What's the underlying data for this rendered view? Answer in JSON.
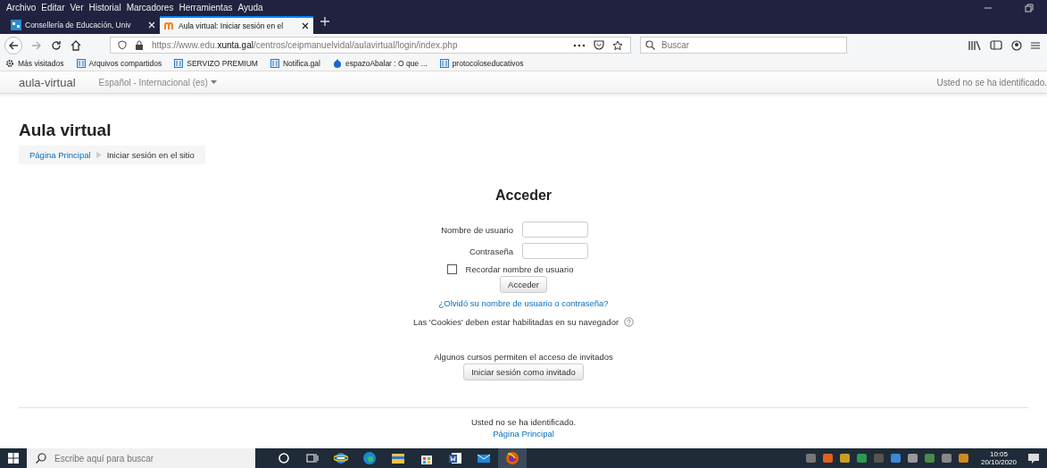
{
  "menu_bar": [
    "Archivo",
    "Editar",
    "Ver",
    "Historial",
    "Marcadores",
    "Herramientas",
    "Ayuda"
  ],
  "tabs": [
    {
      "label": "Consellería de Educación, Univ",
      "selected": false
    },
    {
      "label": "Aula virtual: Iniciar sesión en el",
      "selected": true
    }
  ],
  "address_bar": {
    "url_start": "https://www.edu.",
    "url_domain": "xunta.gal",
    "url_rest": "/centros/ceipmanuelvidal/aulavirtual/login/index.php"
  },
  "search": {
    "placeholder": "Buscar"
  },
  "bookmarks": [
    {
      "label": "Más visitados",
      "kind": "gear"
    },
    {
      "label": "Arquivos compartidos",
      "kind": "site"
    },
    {
      "label": "SERVIZO PREMIUM",
      "kind": "site"
    },
    {
      "label": "Notifica.gal",
      "kind": "site"
    },
    {
      "label": "espazoAbalar : O que ...",
      "kind": "drop"
    },
    {
      "label": "protocoloseducativos",
      "kind": "site"
    }
  ],
  "navbar": {
    "brand": "aula-virtual",
    "language": "Español - Internacional (es)",
    "login_status": "Usted no se ha identificado."
  },
  "page": {
    "heading": "Aula virtual",
    "breadcrumb": [
      "Página Principal",
      "Iniciar sesión en el sitio"
    ]
  },
  "login": {
    "title": "Acceder",
    "username_label": "Nombre de usuario",
    "password_label": "Contraseña",
    "remember": {
      "label": "Recordar nombre de usuario",
      "checked": false
    },
    "submit": "Acceder",
    "forgot_link": "¿Olvidó su nombre de usuario o contraseña?",
    "cookies_note": "Las 'Cookies' deben estar habilitadas en su navegador",
    "guest_note": "Algunos cursos permiten el acceso de invitados",
    "guest_button": "Iniciar sesión como invitado"
  },
  "footer": {
    "status": "Usted no se ha identificado.",
    "home_link": "Página Principal"
  },
  "taskbar": {
    "search_placeholder": "Escribe aquí para buscar",
    "time": "10:05",
    "date": "20/10/2020"
  }
}
